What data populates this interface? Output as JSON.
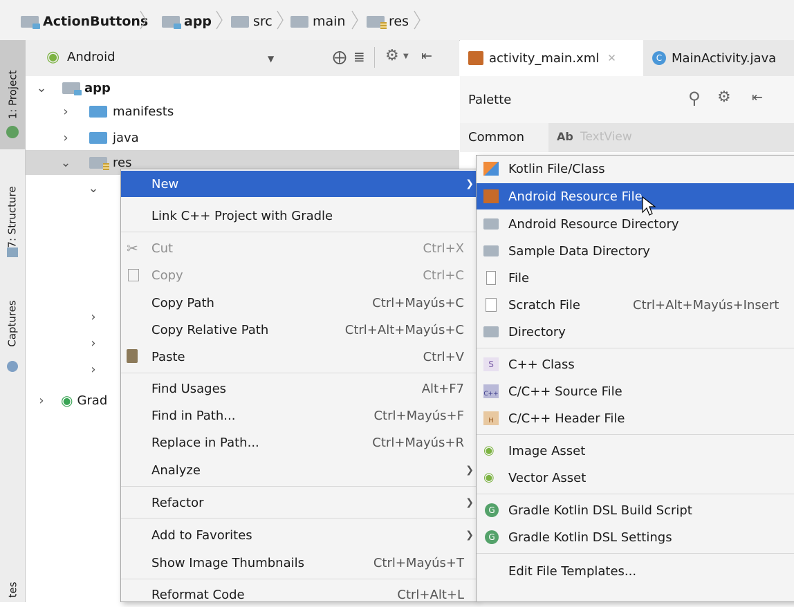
{
  "breadcrumb": {
    "items": [
      "ActionButtons",
      "app",
      "src",
      "main",
      "res"
    ]
  },
  "toolstrip": {
    "tabs": [
      "1: Project",
      "7: Structure",
      "Captures",
      "tes"
    ]
  },
  "project_panel": {
    "view_selector": "Android",
    "tree": {
      "app": "app",
      "manifests": "manifests",
      "java": "java",
      "res": "res",
      "gradle_partial": "Grad"
    }
  },
  "editor": {
    "tabs": [
      "activity_main.xml",
      "MainActivity.java"
    ],
    "palette_title": "Palette",
    "palette_category": "Common",
    "palette_widget_prefix": "Ab",
    "palette_widget": "TextView"
  },
  "context_menu": {
    "items": [
      {
        "label": "New",
        "shortcut": ""
      },
      {
        "label": "Link C++ Project with Gradle",
        "shortcut": ""
      },
      {
        "label": "Cut",
        "shortcut": "Ctrl+X"
      },
      {
        "label": "Copy",
        "shortcut": "Ctrl+C"
      },
      {
        "label": "Copy Path",
        "shortcut": "Ctrl+Mayús+C"
      },
      {
        "label": "Copy Relative Path",
        "shortcut": "Ctrl+Alt+Mayús+C"
      },
      {
        "label": "Paste",
        "shortcut": "Ctrl+V"
      },
      {
        "label": "Find Usages",
        "shortcut": "Alt+F7"
      },
      {
        "label": "Find in Path...",
        "shortcut": "Ctrl+Mayús+F"
      },
      {
        "label": "Replace in Path...",
        "shortcut": "Ctrl+Mayús+R"
      },
      {
        "label": "Analyze",
        "shortcut": ""
      },
      {
        "label": "Refactor",
        "shortcut": ""
      },
      {
        "label": "Add to Favorites",
        "shortcut": ""
      },
      {
        "label": "Show Image Thumbnails",
        "shortcut": "Ctrl+Mayús+T"
      },
      {
        "label": "Reformat Code",
        "shortcut": "Ctrl+Alt+L"
      }
    ]
  },
  "sub_menu": {
    "items": [
      {
        "label": "Kotlin File/Class",
        "shortcut": ""
      },
      {
        "label": "Android Resource File",
        "shortcut": ""
      },
      {
        "label": "Android Resource Directory",
        "shortcut": ""
      },
      {
        "label": "Sample Data Directory",
        "shortcut": ""
      },
      {
        "label": "File",
        "shortcut": ""
      },
      {
        "label": "Scratch File",
        "shortcut": "Ctrl+Alt+Mayús+Insert"
      },
      {
        "label": "Directory",
        "shortcut": ""
      },
      {
        "label": "C++ Class",
        "shortcut": ""
      },
      {
        "label": "C/C++ Source File",
        "shortcut": ""
      },
      {
        "label": "C/C++ Header File",
        "shortcut": ""
      },
      {
        "label": "Image Asset",
        "shortcut": ""
      },
      {
        "label": "Vector Asset",
        "shortcut": ""
      },
      {
        "label": "Gradle Kotlin DSL Build Script",
        "shortcut": ""
      },
      {
        "label": "Gradle Kotlin DSL Settings",
        "shortcut": ""
      },
      {
        "label": "Edit File Templates...",
        "shortcut": ""
      }
    ]
  },
  "colors": {
    "highlight": "#2f65ca",
    "android_green": "#7cb342"
  }
}
